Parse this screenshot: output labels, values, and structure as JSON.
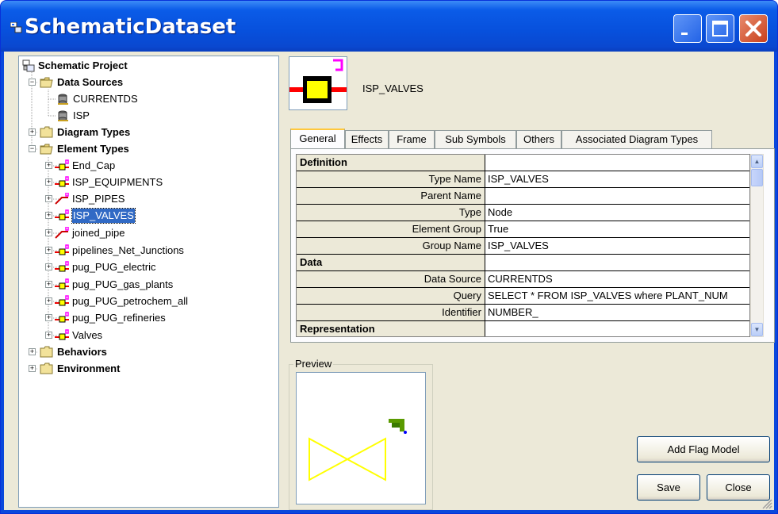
{
  "window": {
    "title": "SchematicDataset"
  },
  "tree": {
    "root": "Schematic Project",
    "data_sources": {
      "label": "Data Sources",
      "items": [
        "CURRENTDS",
        "ISP"
      ]
    },
    "diagram_types": "Diagram Types",
    "element_types": {
      "label": "Element Types",
      "items": [
        "End_Cap",
        "ISP_EQUIPMENTS",
        "ISP_PIPES",
        "ISP_VALVES",
        "joined_pipe",
        "pipelines_Net_Junctions",
        "pug_PUG_electric",
        "pug_PUG_gas_plants",
        "pug_PUG_petrochem_all",
        "pug_PUG_refineries",
        "Valves"
      ],
      "selected": "ISP_VALVES"
    },
    "behaviors": "Behaviors",
    "environment": "Environment"
  },
  "symbol": {
    "name": "ISP_VALVES"
  },
  "tabs": [
    "General",
    "Effects",
    "Frame",
    "Sub Symbols",
    "Others",
    "Associated Diagram Types"
  ],
  "active_tab": "General",
  "properties": {
    "rows": [
      {
        "type": "category",
        "label": "Definition"
      },
      {
        "type": "prop",
        "key": "Type Name",
        "value": "ISP_VALVES"
      },
      {
        "type": "prop",
        "key": "Parent Name",
        "value": ""
      },
      {
        "type": "prop",
        "key": "Type",
        "value": "Node"
      },
      {
        "type": "prop",
        "key": "Element Group",
        "value": "True"
      },
      {
        "type": "prop",
        "key": "Group Name",
        "value": "ISP_VALVES"
      },
      {
        "type": "category",
        "label": "Data"
      },
      {
        "type": "prop",
        "key": "Data Source",
        "value": "CURRENTDS"
      },
      {
        "type": "prop",
        "key": "Query",
        "value": "SELECT * FROM ISP_VALVES where PLANT_NUM"
      },
      {
        "type": "prop",
        "key": "Identifier",
        "value": "NUMBER_"
      },
      {
        "type": "category",
        "label": "Representation"
      }
    ]
  },
  "preview": {
    "label": "Preview"
  },
  "buttons": {
    "add_flag_model": "Add Flag Model",
    "save": "Save",
    "close": "Close"
  },
  "colors": {
    "titlebar": "#0a5ce8",
    "selection": "#316ac5",
    "valve_preview": "#ffff00",
    "symbol_fill": "#ffff00",
    "symbol_pipe": "#ff0000",
    "flag": "#ff00ff"
  }
}
